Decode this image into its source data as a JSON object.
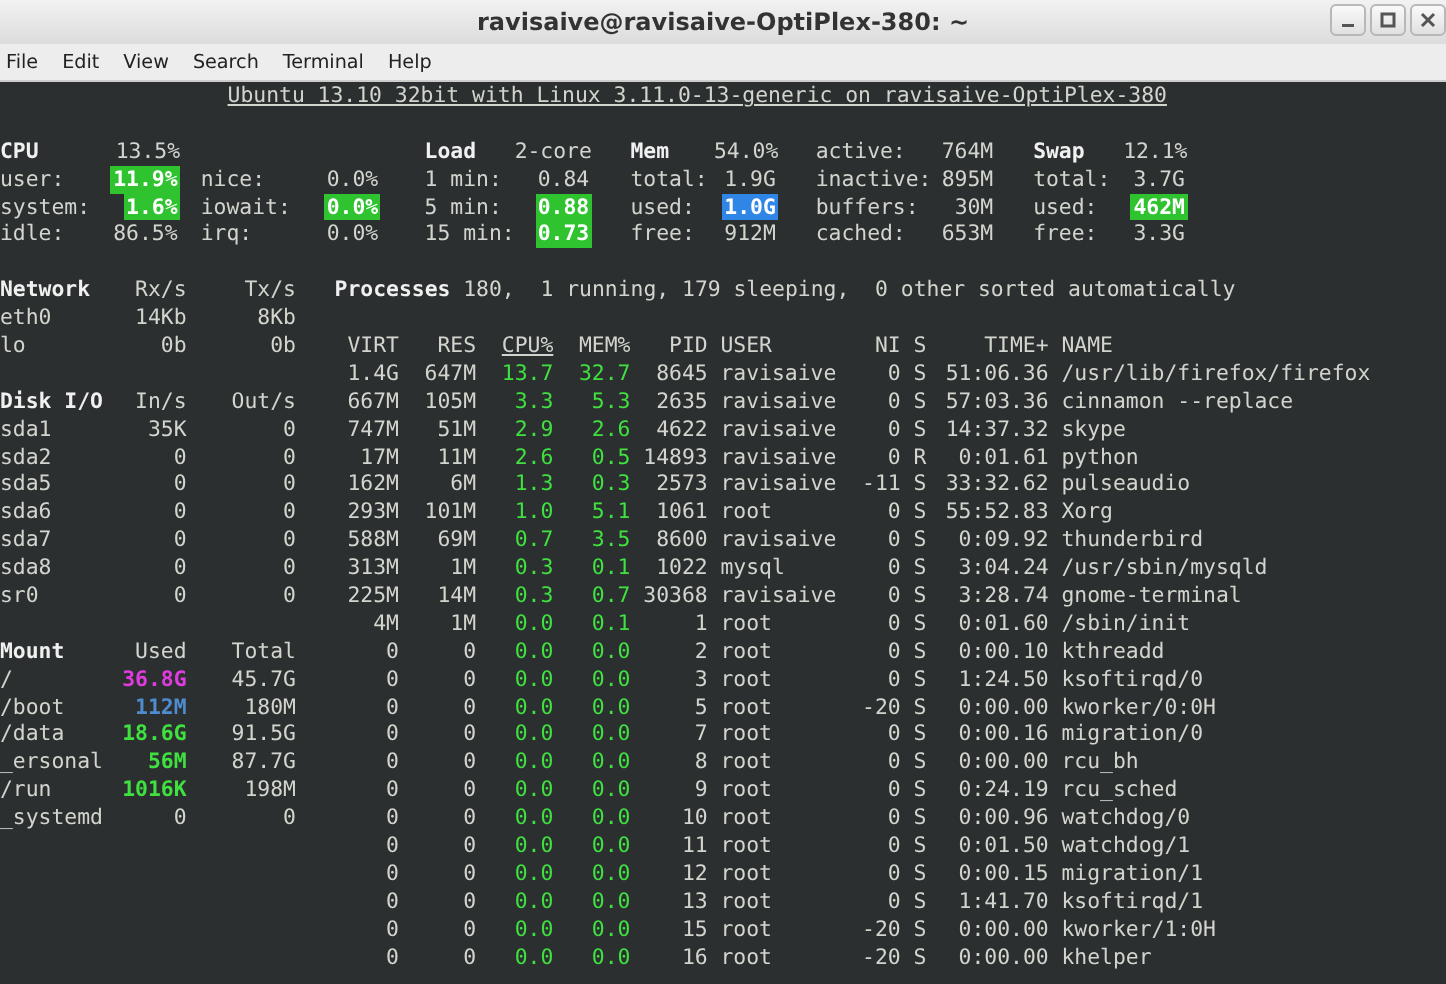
{
  "window": {
    "title": "ravisaive@ravisaive-OptiPlex-380: ~"
  },
  "menu": [
    "File",
    "Edit",
    "View",
    "Search",
    "Terminal",
    "Help"
  ],
  "header": "Ubuntu 13.10 32bit with Linux 3.11.0-13-generic on ravisaive-OptiPlex-380",
  "summary": [
    {
      "title": "CPU",
      "value": "13.5%",
      "rows": [
        {
          "label": "user:",
          "value": "11.9%",
          "color": "#2fc32f"
        },
        {
          "label": "system:",
          "value": "1.6%",
          "color": "#2fc32f"
        },
        {
          "label": "idle:",
          "value": "86.5%"
        }
      ]
    },
    {
      "rows": [
        {
          "label": "nice:",
          "value": "0.0%"
        },
        {
          "label": "iowait:",
          "value": "0.0%",
          "color": "#2fc32f"
        },
        {
          "label": "irq:",
          "value": "0.0%"
        }
      ]
    },
    {
      "title": "Load",
      "value": "2-core",
      "rows": [
        {
          "label": "1 min:",
          "value": "0.84"
        },
        {
          "label": "5 min:",
          "value": "0.88",
          "color": "#2fc32f"
        },
        {
          "label": "15 min:",
          "value": "0.73",
          "color": "#2fc32f"
        }
      ]
    },
    {
      "title": "Mem",
      "value": "54.0%",
      "rows": [
        {
          "label": "total:",
          "value": "1.9G"
        },
        {
          "label": "used:",
          "value": "1.0G",
          "color": "#2f86e6"
        },
        {
          "label": "free:",
          "value": "912M"
        }
      ]
    },
    {
      "rows": [
        {
          "label": "active:",
          "value": "764M"
        },
        {
          "label": "inactive:",
          "value": "895M"
        },
        {
          "label": "buffers:",
          "value": "30M"
        },
        {
          "label": "cached:",
          "value": "653M"
        }
      ]
    },
    {
      "title": "Swap",
      "value": "12.1%",
      "rows": [
        {
          "label": "total:",
          "value": "3.7G"
        },
        {
          "label": "used:",
          "value": "462M",
          "color": "#2fc32f"
        },
        {
          "label": "free:",
          "value": "3.3G"
        }
      ]
    }
  ],
  "network": {
    "columns": [
      "Network",
      "Rx/s",
      "Tx/s"
    ],
    "rows": [
      [
        "eth0",
        "14Kb",
        "8Kb"
      ],
      [
        "lo",
        "0b",
        "0b"
      ]
    ]
  },
  "disk_io": {
    "columns": [
      "Disk I/O",
      "In/s",
      "Out/s"
    ],
    "rows": [
      [
        "sda1",
        "35K",
        "0"
      ],
      [
        "sda2",
        "0",
        "0"
      ],
      [
        "sda5",
        "0",
        "0"
      ],
      [
        "sda6",
        "0",
        "0"
      ],
      [
        "sda7",
        "0",
        "0"
      ],
      [
        "sda8",
        "0",
        "0"
      ],
      [
        "sr0",
        "0",
        "0"
      ]
    ]
  },
  "mounts": {
    "columns": [
      "Mount",
      "Used",
      "Total"
    ],
    "rows": [
      {
        "name": "/",
        "used": "36.8G",
        "total": "45.7G",
        "color": "#e03be0"
      },
      {
        "name": "/boot",
        "used": "112M",
        "total": "180M",
        "color": "#4e8ccf"
      },
      {
        "name": "/data",
        "used": "18.6G",
        "total": "91.5G",
        "color": "#3fe03f"
      },
      {
        "name": "_ersonal",
        "used": "56M",
        "total": "87.7G",
        "color": "#3fe03f"
      },
      {
        "name": "/run",
        "used": "1016K",
        "total": "198M",
        "color": "#3fe03f"
      },
      {
        "name": "_systemd",
        "used": "0",
        "total": "0"
      }
    ]
  },
  "processes": {
    "label": "Processes",
    "summary": "180,  1 running, 179 sleeping,  0 other sorted automatically",
    "columns": [
      {
        "label": "VIRT",
        "sorted": false
      },
      {
        "label": "RES",
        "sorted": false
      },
      {
        "label": "CPU%",
        "sorted": true
      },
      {
        "label": "MEM%",
        "sorted": false
      },
      {
        "label": "PID",
        "sorted": false
      },
      {
        "label": "USER",
        "sorted": false
      },
      {
        "label": "NI",
        "sorted": false
      },
      {
        "label": "S",
        "sorted": false
      },
      {
        "label": "TIME+",
        "sorted": false
      },
      {
        "label": "NAME",
        "sorted": false
      }
    ],
    "rows": [
      [
        "1.4G",
        "647M",
        "13.7",
        "32.7",
        "8645",
        "ravisaive",
        "0",
        "S",
        "51:06.36",
        "/usr/lib/firefox/firefox"
      ],
      [
        "667M",
        "105M",
        "3.3",
        "5.3",
        "2635",
        "ravisaive",
        "0",
        "S",
        "57:03.36",
        "cinnamon --replace"
      ],
      [
        "747M",
        "51M",
        "2.9",
        "2.6",
        "4622",
        "ravisaive",
        "0",
        "S",
        "14:37.32",
        "skype"
      ],
      [
        "17M",
        "11M",
        "2.6",
        "0.5",
        "14893",
        "ravisaive",
        "0",
        "R",
        "0:01.61",
        "python"
      ],
      [
        "162M",
        "6M",
        "1.3",
        "0.3",
        "2573",
        "ravisaive",
        "-11",
        "S",
        "33:32.62",
        "pulseaudio"
      ],
      [
        "293M",
        "101M",
        "1.0",
        "5.1",
        "1061",
        "root",
        "0",
        "S",
        "55:52.83",
        "Xorg"
      ],
      [
        "588M",
        "69M",
        "0.7",
        "3.5",
        "8600",
        "ravisaive",
        "0",
        "S",
        "0:09.92",
        "thunderbird"
      ],
      [
        "313M",
        "1M",
        "0.3",
        "0.1",
        "1022",
        "mysql",
        "0",
        "S",
        "3:04.24",
        "/usr/sbin/mysqld"
      ],
      [
        "225M",
        "14M",
        "0.3",
        "0.7",
        "30368",
        "ravisaive",
        "0",
        "S",
        "3:28.74",
        "gnome-terminal"
      ],
      [
        "4M",
        "1M",
        "0.0",
        "0.1",
        "1",
        "root",
        "0",
        "S",
        "0:01.60",
        "/sbin/init"
      ],
      [
        "0",
        "0",
        "0.0",
        "0.0",
        "2",
        "root",
        "0",
        "S",
        "0:00.10",
        "kthreadd"
      ],
      [
        "0",
        "0",
        "0.0",
        "0.0",
        "3",
        "root",
        "0",
        "S",
        "1:24.50",
        "ksoftirqd/0"
      ],
      [
        "0",
        "0",
        "0.0",
        "0.0",
        "5",
        "root",
        "-20",
        "S",
        "0:00.00",
        "kworker/0:0H"
      ],
      [
        "0",
        "0",
        "0.0",
        "0.0",
        "7",
        "root",
        "0",
        "S",
        "0:00.16",
        "migration/0"
      ],
      [
        "0",
        "0",
        "0.0",
        "0.0",
        "8",
        "root",
        "0",
        "S",
        "0:00.00",
        "rcu_bh"
      ],
      [
        "0",
        "0",
        "0.0",
        "0.0",
        "9",
        "root",
        "0",
        "S",
        "0:24.19",
        "rcu_sched"
      ],
      [
        "0",
        "0",
        "0.0",
        "0.0",
        "10",
        "root",
        "0",
        "S",
        "0:00.96",
        "watchdog/0"
      ],
      [
        "0",
        "0",
        "0.0",
        "0.0",
        "11",
        "root",
        "0",
        "S",
        "0:01.50",
        "watchdog/1"
      ],
      [
        "0",
        "0",
        "0.0",
        "0.0",
        "12",
        "root",
        "0",
        "S",
        "0:00.15",
        "migration/1"
      ],
      [
        "0",
        "0",
        "0.0",
        "0.0",
        "13",
        "root",
        "0",
        "S",
        "1:41.70",
        "ksoftirqd/1"
      ],
      [
        "0",
        "0",
        "0.0",
        "0.0",
        "15",
        "root",
        "-20",
        "S",
        "0:00.00",
        "kworker/1:0H"
      ],
      [
        "0",
        "0",
        "0.0",
        "0.0",
        "16",
        "root",
        "-20",
        "S",
        "0:00.00",
        "khelper"
      ]
    ]
  }
}
